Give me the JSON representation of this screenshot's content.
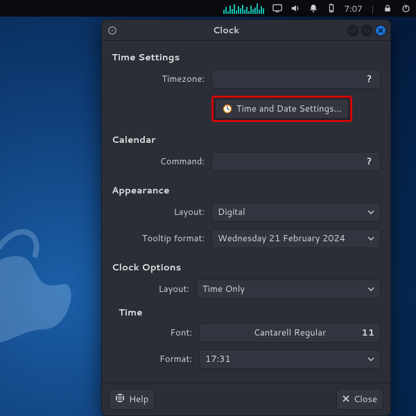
{
  "panel": {
    "time": "7:07",
    "battery_pct": 1
  },
  "window": {
    "title": "Clock"
  },
  "timeSettings": {
    "heading": "Time Settings",
    "timezone_label": "Timezone:",
    "timezone_value": "",
    "button": "Time and Date Settings..."
  },
  "calendar": {
    "heading": "Calendar",
    "command_label": "Command:",
    "command_value": ""
  },
  "appearance": {
    "heading": "Appearance",
    "layout_label": "Layout:",
    "layout_value": "Digital",
    "tooltip_label": "Tooltip format:",
    "tooltip_value": "Wednesday 21 February 2024"
  },
  "clockOptions": {
    "heading": "Clock Options",
    "layout_label": "Layout:",
    "layout_value": "Time Only",
    "time_heading": "Time",
    "font_label": "Font:",
    "font_name": "Cantarell Regular",
    "font_size": "11",
    "format_label": "Format:",
    "format_value": "17:31"
  },
  "footer": {
    "help": "Help",
    "close": "Close"
  }
}
